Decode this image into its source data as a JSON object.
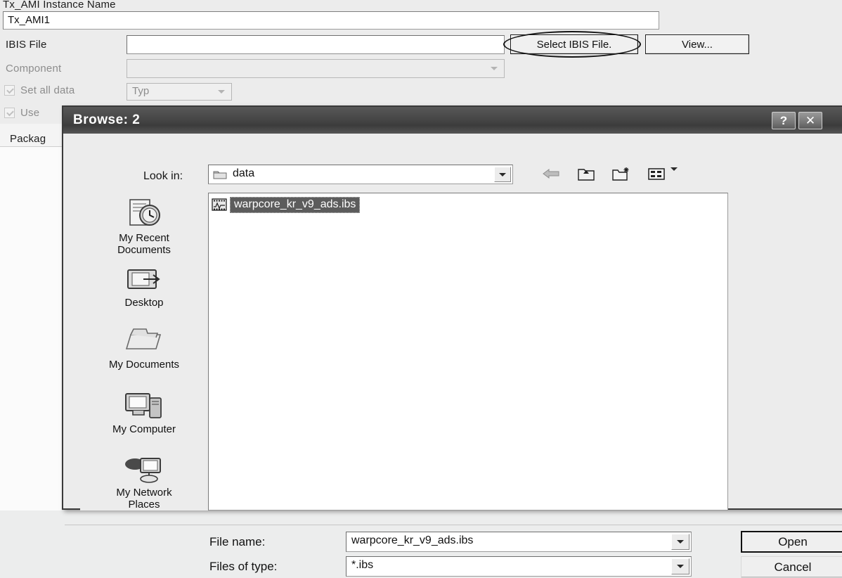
{
  "background": {
    "instance_name_label": "Tx_AMI Instance Name",
    "instance_name_value": "Tx_AMI1",
    "ibis_file_label": "IBIS File",
    "ibis_file_value": "",
    "component_label": "Component",
    "component_value": "",
    "set_all_data_label": "Set all data",
    "typ_value": "Typ",
    "use_label": "Use",
    "package_label": "Packag",
    "select_ibis_button": "Select IBIS File.",
    "view_button": "View..."
  },
  "dialog": {
    "title": "Browse: 2",
    "help_button": "?",
    "close_button": "✕",
    "lookin_label": "Look in:",
    "lookin_value": "data",
    "toolbar": {
      "back": "back-icon",
      "up": "up-one-level-icon",
      "new_folder": "new-folder-icon",
      "views": "views-icon"
    },
    "places": [
      {
        "label": "My Recent\nDocuments",
        "icon": "recent-documents-icon"
      },
      {
        "label": "Desktop",
        "icon": "desktop-icon"
      },
      {
        "label": "My Documents",
        "icon": "my-documents-icon"
      },
      {
        "label": "My Computer",
        "icon": "my-computer-icon"
      },
      {
        "label": "My Network\nPlaces",
        "icon": "my-network-places-icon"
      }
    ],
    "files": [
      {
        "name": "warpcore_kr_v9_ads.ibs",
        "icon": "ibis-file-icon",
        "selected": true
      }
    ],
    "filename_label": "File name:",
    "filename_value": "warpcore_kr_v9_ads.ibs",
    "filetype_label": "Files of type:",
    "filetype_value": "*.ibs",
    "open_button": "Open",
    "cancel_button": "Cancel"
  },
  "colors": {
    "dialog_title_bar": "#4a4a4a",
    "selection": "#5c5c5c",
    "window_face": "#ececec",
    "field_bg": "#ffffff"
  }
}
